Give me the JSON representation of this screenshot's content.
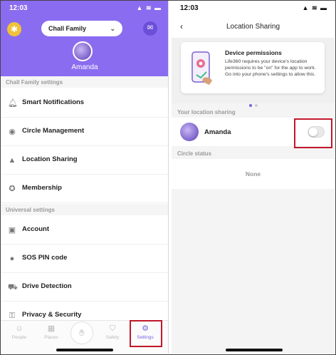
{
  "left_screen": {
    "status_bar": {
      "time": "12:03",
      "indicators": "▲ ≋ ▬"
    },
    "header": {
      "settings_icon": "gear-icon",
      "circle_selector": {
        "value": "Chall Family",
        "icon": "chevron-down-icon"
      },
      "messages_icon": "chat-icon",
      "user_name": "Amanda",
      "background_color": "#8a6cf0"
    },
    "circle_settings": {
      "section_title": "Chall Family settings",
      "items": [
        {
          "label": "Smart Notifications",
          "icon": "bell-icon"
        },
        {
          "label": "Circle Management",
          "icon": "circle-icon"
        },
        {
          "label": "Location Sharing",
          "icon": "location-arrow-icon"
        },
        {
          "label": "Membership",
          "icon": "membership-icon"
        }
      ]
    },
    "universal_settings": {
      "section_title": "Universal settings",
      "items": [
        {
          "label": "Account",
          "icon": "account-icon"
        },
        {
          "label": "SOS PIN code",
          "icon": "sos-icon"
        },
        {
          "label": "Drive Detection",
          "icon": "car-icon"
        },
        {
          "label": "Privacy & Security",
          "icon": "key-icon"
        }
      ]
    },
    "tab_bar": {
      "tabs": [
        {
          "label": "People",
          "icon": "people-icon",
          "active": false
        },
        {
          "label": "Places",
          "icon": "places-icon",
          "active": false
        },
        {
          "label": "Safety",
          "icon": "shield-icon",
          "active": false
        },
        {
          "label": "Settings",
          "icon": "gear-icon",
          "active": true
        }
      ],
      "center_button_icon": "sos-hand-icon",
      "active_color": "#7a5fe3"
    }
  },
  "right_screen": {
    "status_bar": {
      "time": "12:03",
      "indicators": "▲ ≋ ▬"
    },
    "nav": {
      "back_icon": "chevron-left-icon",
      "title": "Location Sharing"
    },
    "permission_card": {
      "title": "Device permissions",
      "body": "Life360 requires your device's location permissions to be \"on\" for the app to work. Go into your phone's settings to allow this.",
      "illustration": "phone-location-illustration",
      "page_count": 2,
      "current_page": 1
    },
    "your_sharing": {
      "section_title": "Your location sharing",
      "member_name": "Amanda",
      "sharing_enabled": false
    },
    "circle_status": {
      "section_title": "Circle status",
      "value": "None"
    }
  },
  "highlight_color": "#c0182b"
}
